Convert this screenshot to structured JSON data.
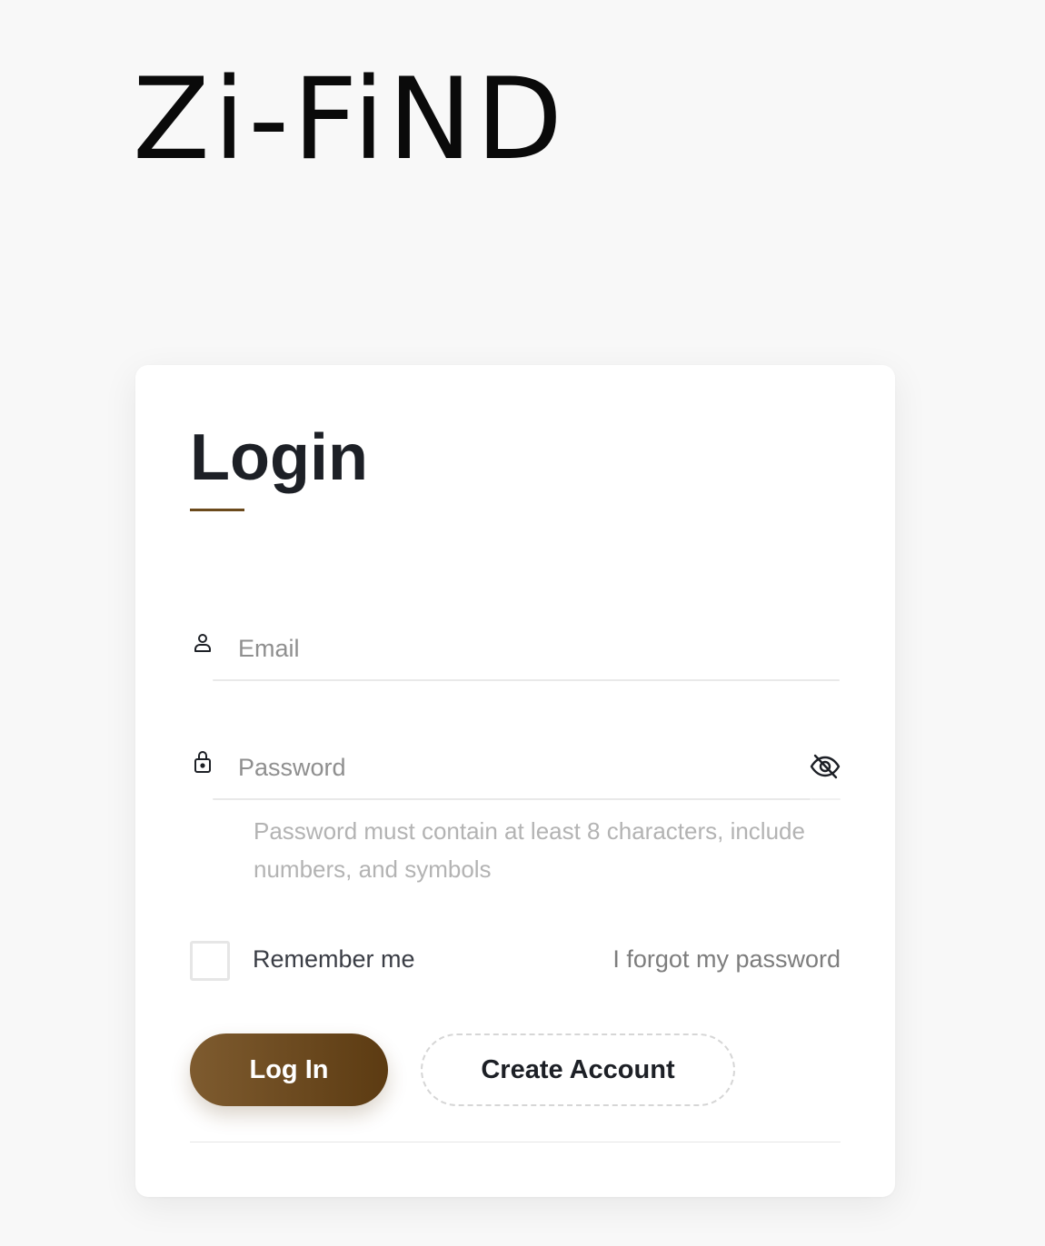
{
  "brand": {
    "logo_text": "Zi-FiND"
  },
  "login": {
    "title": "Login",
    "email": {
      "placeholder": "Email",
      "value": "",
      "icon": "user-icon"
    },
    "password": {
      "placeholder": "Password",
      "value": "",
      "icon": "lock-icon",
      "toggle_icon": "eye-off-icon",
      "hint": "Password must contain at least 8 characters, include numbers, and symbols"
    },
    "remember_label": "Remember me",
    "remember_checked": false,
    "forgot_label": "I forgot my password",
    "login_button_label": "Log In",
    "create_account_label": "Create Account"
  },
  "colors": {
    "page_background": "#f8f8f8",
    "card_background": "#ffffff",
    "accent": "#6b4a1c",
    "button_gradient_start": "#7e5b2f",
    "button_gradient_end": "#5c3b12",
    "heading": "#1d2026",
    "placeholder": "#8f8f8f",
    "hint": "#b3b3b3"
  }
}
